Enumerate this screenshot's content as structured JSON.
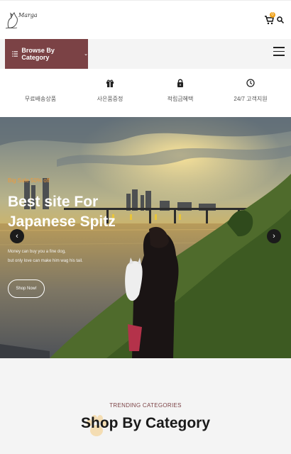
{
  "header": {
    "logo_text": "Marga",
    "cart_count": "0"
  },
  "navbar": {
    "browse_label": "Browse By Category"
  },
  "features": [
    {
      "label": "무료배송상품",
      "icon": "box-icon"
    },
    {
      "label": "사은품증정",
      "icon": "gift-icon"
    },
    {
      "label": "적립금혜택",
      "icon": "lock-icon"
    },
    {
      "label": "24/7 고객지원",
      "icon": "clock-icon"
    }
  ],
  "hero": {
    "subtitle": "Big Sale 50% off",
    "title": "Best site For Japanese Spitz",
    "desc_line1": "Money can buy you a fine dog,",
    "desc_line2": "but only love can make him wag his tail.",
    "button": "Shop Now!",
    "prev": "‹",
    "next": "›"
  },
  "trending": {
    "subtitle": "TRENDING CATEGORIES",
    "title": "Shop By Category"
  },
  "colors": {
    "brand": "#7b4245",
    "accent": "#f0a21a"
  }
}
